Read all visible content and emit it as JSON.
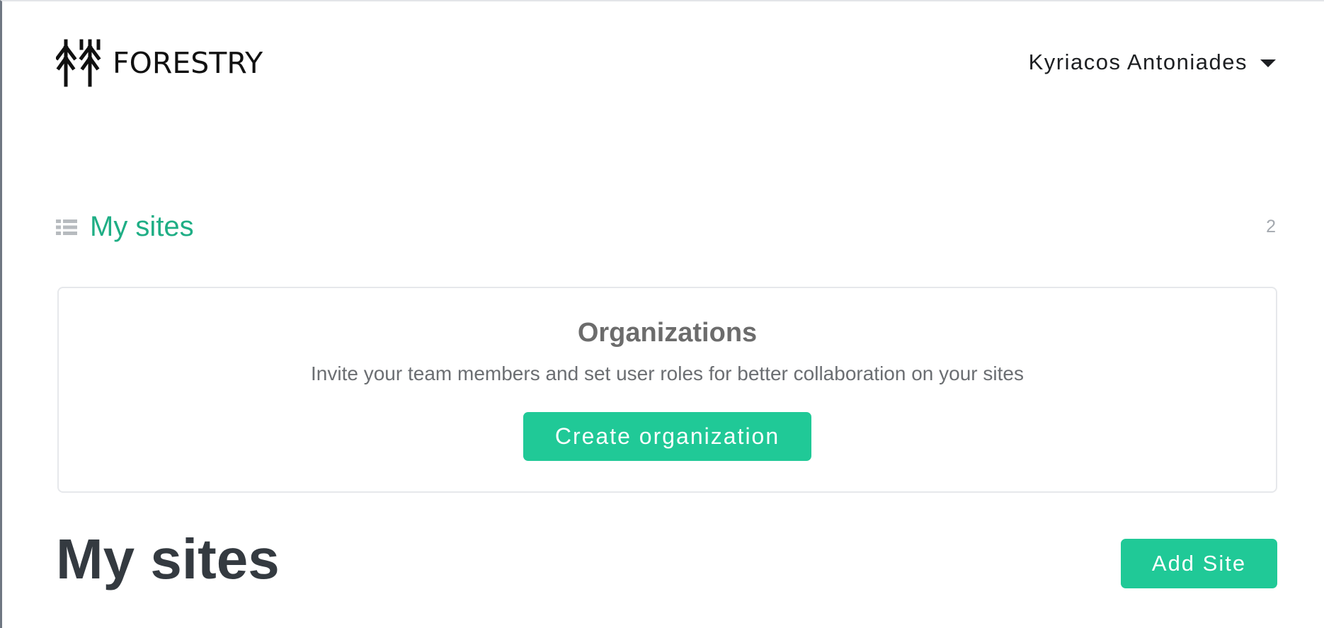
{
  "header": {
    "logo_text": "FORESTRY",
    "user_name": "Kyriacos Antoniades"
  },
  "section": {
    "icon": "list-icon",
    "title": "My sites",
    "count": "2",
    "accent_color": "#1fae85"
  },
  "org_card": {
    "title": "Organizations",
    "description": "Invite your team members and set user roles for better collaboration on your sites",
    "button_label": "Create organization",
    "button_color": "#20c997"
  },
  "main": {
    "heading": "My sites",
    "add_button_label": "Add Site"
  }
}
